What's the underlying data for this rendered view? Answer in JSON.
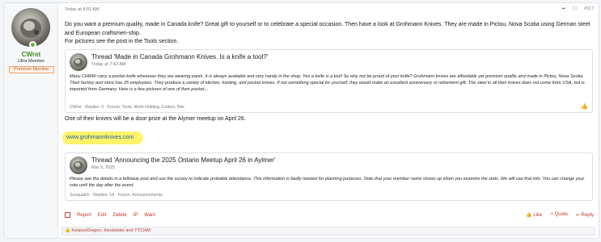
{
  "user": {
    "name": "CWret",
    "title": "Ultra Member",
    "banner": "Premium Member"
  },
  "post": {
    "date": "Today at 8:01 AM",
    "number": "#117",
    "paragraph1": "Do you want a premium quality, made in Canada knife? Great gift to yourself or to celebrate a special occasion. Then have a look at Grohmann Knives. They are made in Pictou, Nova Scotia using German steel and European craftsmen-ship.",
    "paragraph2": "For pictures see the post in the Tools section.",
    "after_quote": "One of their knives will be a door prize at the Alymer meetup on April 26.",
    "link": "www.grohmannknives.com"
  },
  "quote1": {
    "title": "Thread 'Made in Canada Grohmann Knives. Is a knife a tool?'",
    "date": "Today at 7:42 AM",
    "text": "Many CHMW carry a pocket knife whenever they are wearing pants. It is always available and very handy in the shop. Yes a knife is a tool! So why not be proud of your knife? Grohmann knives are affordable yet premium quality and made in Pictou, Nova Scotia. Their factory and store has 25 employees. They produce a variety of kitchen, hunting, and pocket knives. If not something special for yourself, they would make an excellent anniversary or retirement gift. The steel in all their knives does not come from USA, but is imported from Germany. Here is a few pictures of one of their pocket...",
    "footer": "CWret · Replies: 0 · Forum: Tools, Work Holding, Cutters, Bits"
  },
  "quote2": {
    "title": "Thread 'Announcing the 2025 Ontario Meetup April 26 in Aylmer'",
    "date": "Mar 9, 2025",
    "text": "Please see the details in a followup post and use the survey to indicate probable attendance. This information is badly needed for planning purposes. Note that your member name shows up when you examine the stats. We will use that info. You can change your vote until the day after the event.",
    "footer": "Susquatch · Replies: 18 · Forum: Announcements"
  },
  "actions": {
    "left": [
      "Report",
      "Edit",
      "Delete",
      "IP",
      "Warn"
    ],
    "like": "Like",
    "quote": "+ Quote",
    "reply": "Reply"
  },
  "reactions": "KeeponDragon, thestelster and YYCHM",
  "colors": {
    "accent": "#c0392b",
    "username": "#3f8c22",
    "highlight": "#fff36a",
    "link": "#1b5fa6"
  },
  "icons": {
    "share": "share-icon",
    "bookmark": "bookmark-icon",
    "like": "thumbs-up-icon",
    "reply": "reply-icon"
  }
}
